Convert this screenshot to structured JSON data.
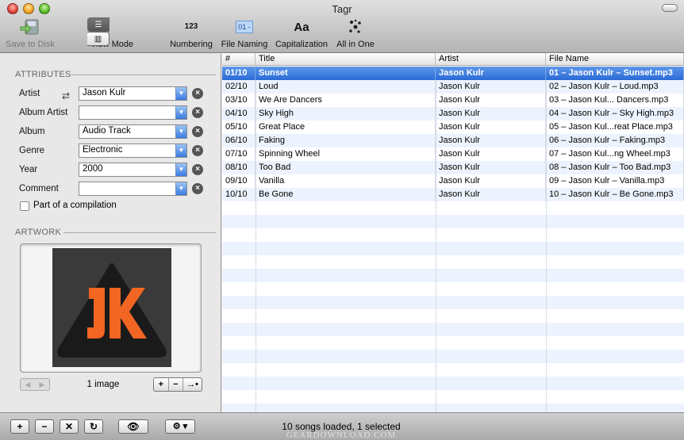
{
  "window": {
    "title": "Tagr"
  },
  "toolbar": {
    "save": "Save to Disk",
    "view_mode": "View Mode",
    "numbering": "Numbering",
    "numbering_glyph": "123",
    "file_naming": "File Naming",
    "file_naming_glyph": "01 -",
    "capitalization": "Capitalization",
    "capitalization_glyph": "Aa",
    "all_in_one": "All in One"
  },
  "attributes": {
    "header": "ATTRIBUTES",
    "fields": [
      {
        "label": "Artist",
        "value": "Jason Kulr"
      },
      {
        "label": "Album Artist",
        "value": ""
      },
      {
        "label": "Album",
        "value": "Audio Track"
      },
      {
        "label": "Genre",
        "value": "Electronic"
      },
      {
        "label": "Year",
        "value": "2000"
      },
      {
        "label": "Comment",
        "value": ""
      }
    ],
    "compilation_label": "Part of a compilation",
    "compilation_checked": false
  },
  "artwork": {
    "header": "ARTWORK",
    "count_label": "1 image",
    "logo_bg": "#3a3a3a",
    "logo_accent": "#f26522"
  },
  "table": {
    "headers": [
      "#",
      "Title",
      "Artist",
      "File Name"
    ],
    "selected_index": 0,
    "rows": [
      [
        "01/10",
        "Sunset",
        "Jason Kulr",
        "01 – Jason Kulr – Sunset.mp3"
      ],
      [
        "02/10",
        "Loud",
        "Jason Kulr",
        "02 – Jason Kulr – Loud.mp3"
      ],
      [
        "03/10",
        "We Are Dancers",
        "Jason Kulr",
        "03 – Jason Kul... Dancers.mp3"
      ],
      [
        "04/10",
        "Sky High",
        "Jason Kulr",
        "04 – Jason Kulr – Sky High.mp3"
      ],
      [
        "05/10",
        "Great Place",
        "Jason Kulr",
        "05 – Jason Kul...reat Place.mp3"
      ],
      [
        "06/10",
        "Faking",
        "Jason Kulr",
        "06 – Jason Kulr – Faking.mp3"
      ],
      [
        "07/10",
        "Spinning Wheel",
        "Jason Kulr",
        "07 – Jason Kul...ng Wheel.mp3"
      ],
      [
        "08/10",
        "Too Bad",
        "Jason Kulr",
        "08 – Jason Kulr – Too Bad.mp3"
      ],
      [
        "09/10",
        "Vanilla",
        "Jason Kulr",
        "09 – Jason Kulr – Vanilla.mp3"
      ],
      [
        "10/10",
        "Be Gone",
        "Jason Kulr",
        "10 – Jason Kulr – Be Gone.mp3"
      ]
    ]
  },
  "status": {
    "text": "10 songs loaded, 1 selected",
    "watermark": "GEARDOWNLOAD.COM"
  },
  "colors": {
    "selection": "#3a78dc",
    "stripe": "#edf3fe",
    "accent": "#f26522"
  }
}
